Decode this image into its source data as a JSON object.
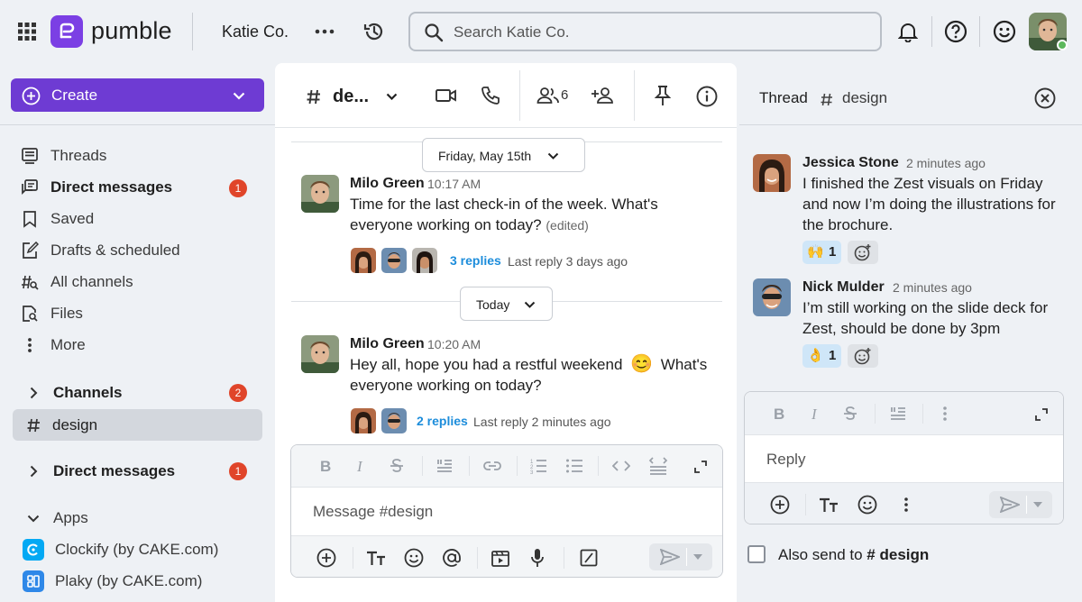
{
  "app": {
    "name": "pumble",
    "workspace": "Katie Co."
  },
  "search": {
    "placeholder": "Search Katie Co."
  },
  "sidebar": {
    "create_label": "Create",
    "nav": [
      {
        "label": "Threads",
        "icon": "threads-icon"
      },
      {
        "label": "Direct messages",
        "icon": "direct-messages-icon",
        "badge": "1",
        "bold": true
      },
      {
        "label": "Saved",
        "icon": "bookmark-icon"
      },
      {
        "label": "Drafts & scheduled",
        "icon": "drafts-icon"
      },
      {
        "label": "All channels",
        "icon": "all-channels-icon"
      },
      {
        "label": "Files",
        "icon": "files-icon"
      },
      {
        "label": "More",
        "icon": "more-vertical-icon"
      }
    ],
    "channels_label": "Channels",
    "channels_badge": "2",
    "design_channel": "design",
    "dm_section_label": "Direct messages",
    "dm_section_badge": "1",
    "apps_label": "Apps",
    "apps": [
      {
        "label": "Clockify (by CAKE.com)",
        "color": "#03a9f4"
      },
      {
        "label": "Plaky (by CAKE.com)",
        "color": "#2f88e8"
      }
    ]
  },
  "channel": {
    "title": "de...",
    "member_count": "6",
    "date_divider_1": "Friday, May 15th",
    "date_divider_2": "Today",
    "messages": [
      {
        "author": "Milo Green",
        "time": "10:17 AM",
        "text": "Time for the last check-in of the week. What's everyone working on today?",
        "edited": "(edited)",
        "replies": "3 replies",
        "last_reply": "Last reply 3 days ago"
      },
      {
        "author": "Milo Green",
        "time": "10:20 AM",
        "text_before": "Hey all, hope you had a restful weekend",
        "emoji": "😊",
        "text_after": "What's everyone working on today?",
        "replies": "2 replies",
        "last_reply": "Last reply 2 minutes ago"
      }
    ],
    "composer_placeholder": "Message #design"
  },
  "thread": {
    "title": "Thread",
    "channel": "design",
    "messages": [
      {
        "author": "Jessica Stone",
        "time": "2 minutes ago",
        "text": "I finished the Zest visuals on Friday and now I’m doing the illustrations for the brochure.",
        "reaction_emoji": "🙌",
        "reaction_count": "1"
      },
      {
        "author": "Nick Mulder",
        "time": "2 minutes ago",
        "text": "I’m still working on the slide deck for Zest, should be done by 3pm",
        "reaction_emoji": "👌",
        "reaction_count": "1"
      }
    ],
    "reply_placeholder": "Reply",
    "also_send_prefix": "Also send to",
    "also_send_channel": "# design"
  },
  "colors": {
    "brand": "#6e3bd3",
    "badge": "#e0452a",
    "link": "#1d8ddb",
    "reaction_bg": "#cfe6f8"
  }
}
